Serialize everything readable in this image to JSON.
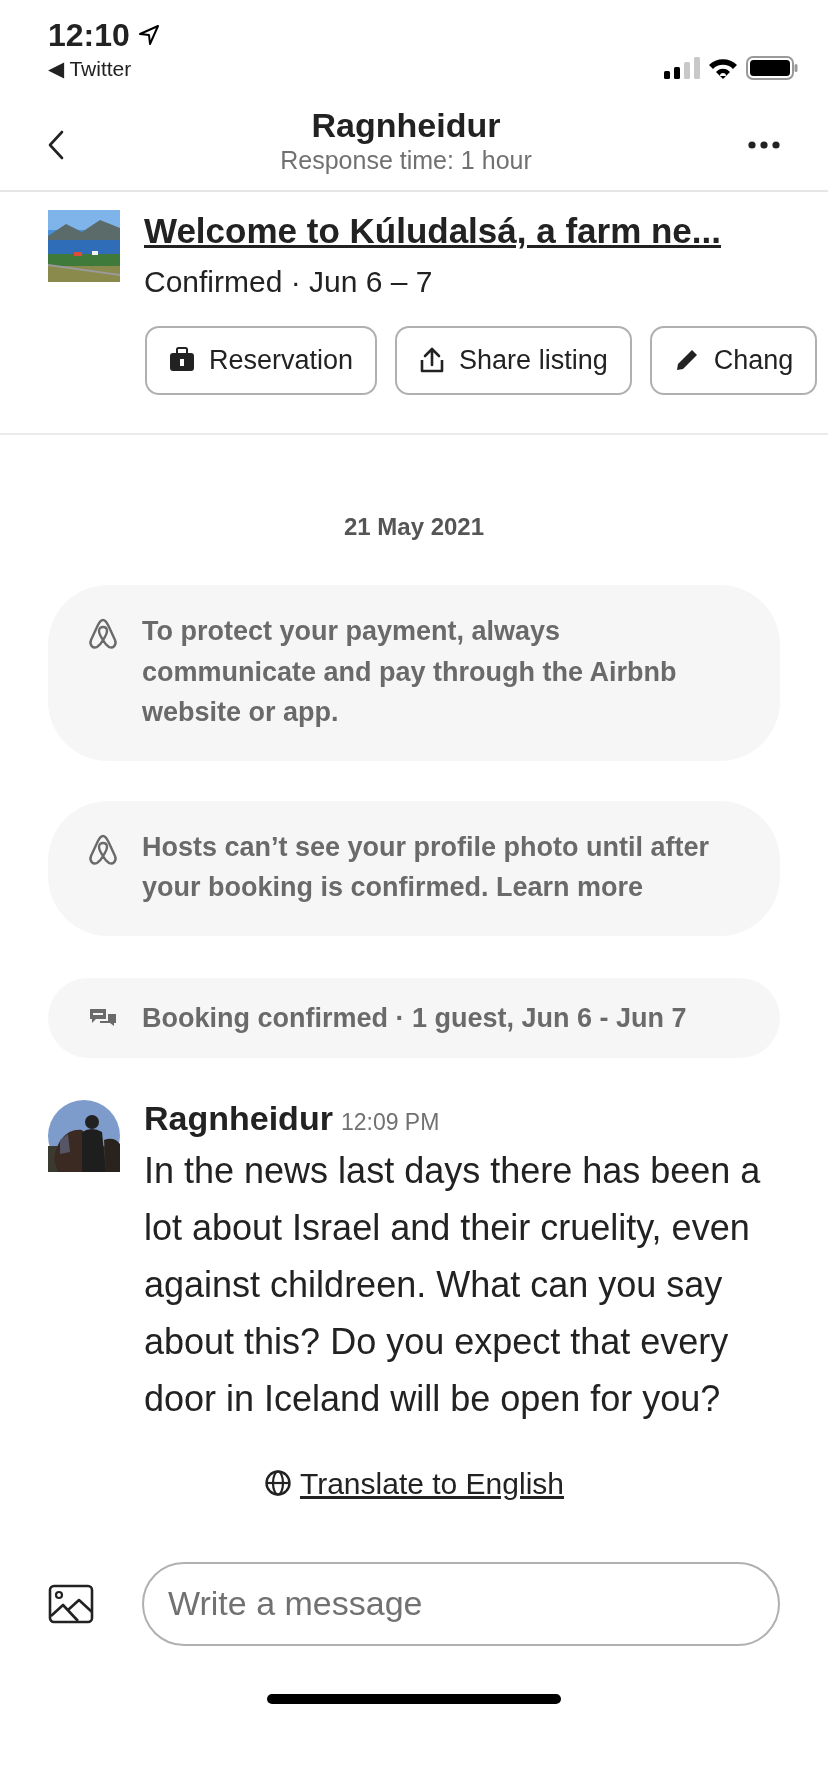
{
  "status_bar": {
    "time": "12:10",
    "back_app": "◀ Twitter"
  },
  "header": {
    "title": "Ragnheidur",
    "subtitle": "Response time: 1 hour"
  },
  "listing": {
    "title": "Welcome to Kúludalsá, a farm ne...",
    "status": "Confirmed · Jun 6 – 7"
  },
  "actions": [
    {
      "kind": "reservation",
      "label": "Reservation"
    },
    {
      "kind": "share",
      "label": "Share listing"
    },
    {
      "kind": "edit",
      "label": "Chang"
    }
  ],
  "date_divider": "21 May 2021",
  "notices": [
    {
      "kind": "airbnb",
      "text": "To protect your payment, always communicate and pay through the Airbnb website or app."
    },
    {
      "kind": "airbnb",
      "text": "Hosts can’t see your profile photo until after your booking is confirmed.",
      "link": "Learn more"
    },
    {
      "kind": "chat",
      "text": "Booking confirmed · 1 guest, Jun 6 - Jun 7"
    }
  ],
  "message": {
    "sender": "Ragnheidur",
    "time": "12:09 PM",
    "text": "In the news last days there has been a lot about Israel and their cruelity, even against childreen. What can you say about this? Do you expect that every door in Iceland will be open for you?"
  },
  "translate_link": "Translate to English",
  "composer": {
    "placeholder": "Write a message"
  }
}
